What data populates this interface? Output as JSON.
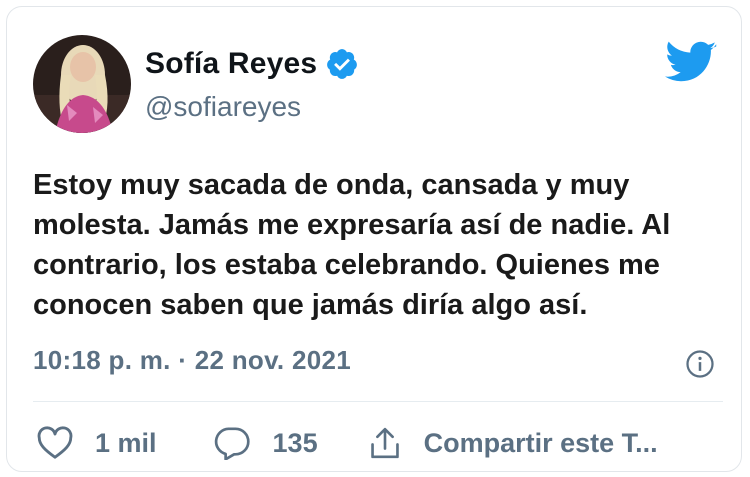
{
  "author": {
    "name": "Sofía Reyes",
    "handle": "@sofiareyes",
    "verified": true
  },
  "tweet": {
    "text": "Estoy muy sacada de onda, cansada y muy molesta. Jamás me expresaría así de nadie. Al contrario, los estaba celebrando. Quienes me conocen saben que jamás diría algo así.",
    "timestamp": "10:18 p. m. · 22 nov. 2021"
  },
  "actions": {
    "likes_label": "1 mil",
    "replies_label": "135",
    "share_label": "Compartir este T..."
  },
  "icons": {
    "brand": "twitter-bird-icon",
    "verified": "verified-badge-icon",
    "info": "info-icon",
    "like": "heart-icon",
    "reply": "speech-bubble-icon",
    "share": "share-upload-icon"
  },
  "colors": {
    "twitter_blue": "#1d9bf0",
    "secondary_text": "#5b7083",
    "primary_text": "#1a1a1a"
  }
}
